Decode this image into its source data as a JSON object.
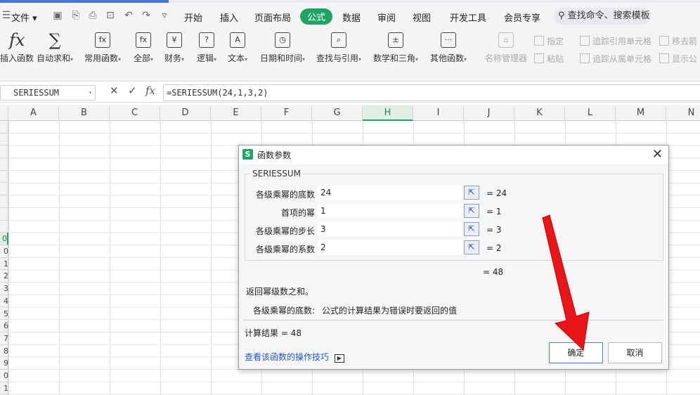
{
  "menu": {
    "file": "文件",
    "tabs": [
      "开始",
      "插入",
      "页面布局",
      "公式",
      "数据",
      "审阅",
      "视图",
      "开发工具",
      "会员专享"
    ],
    "active_tab": "公式",
    "search": "查找命令、搜索模板"
  },
  "ribbon": {
    "buttons": [
      {
        "icon": "fx",
        "label": "插入函数"
      },
      {
        "icon": "∑",
        "label": "自动求和"
      },
      {
        "icon": "fx",
        "label": "常用函数"
      },
      {
        "icon": "fx",
        "label": "全部"
      },
      {
        "icon": "¥",
        "label": "财务"
      },
      {
        "icon": "?",
        "label": "逻辑"
      },
      {
        "icon": "A",
        "label": "文本"
      },
      {
        "icon": "◷",
        "label": "日期和时间"
      },
      {
        "icon": "⌕",
        "label": "查找与引用"
      },
      {
        "icon": "±",
        "label": "数学和三角"
      },
      {
        "icon": "···",
        "label": "其他函数"
      }
    ],
    "name_manager": "名称管理器",
    "assign": "指定",
    "paste": "粘贴",
    "trace_precedents": "追踪引用单元格",
    "trace_dependents": "追踪从属单元格",
    "remove_arrows": "移去箭",
    "show_formulas": "显示公"
  },
  "formula_bar": {
    "name_box": "SERIESSUM",
    "formula": "=SERIESSUM(24,1,3,2)"
  },
  "columns": [
    "A",
    "B",
    "C",
    "D",
    "E",
    "F",
    "G",
    "H",
    "I",
    "J",
    "K",
    "L",
    "M",
    "N"
  ],
  "selected_column": "H",
  "rows": [
    "",
    "",
    "",
    "",
    "",
    "",
    "",
    "",
    "",
    "0",
    "0",
    "1",
    "2",
    "3",
    "4",
    "5",
    "6",
    "7",
    "8",
    "9",
    "0",
    "1"
  ],
  "dialog": {
    "title": "函数参数",
    "function_name": "SERIESSUM",
    "params": [
      {
        "label": "各级乘幂的底数",
        "value": "24",
        "result": "= 24"
      },
      {
        "label": "首项的幂",
        "value": "1",
        "result": "= 1"
      },
      {
        "label": "各级乘幂的步长",
        "value": "3",
        "result": "= 3"
      },
      {
        "label": "各级乘幂的系数",
        "value": "2",
        "result": "= 2"
      }
    ],
    "total": "= 48",
    "description": "返回幂级数之和。",
    "param_help_label": "各级乘幂的底数:",
    "param_help_text": "公式的计算结果为错误时要返回的值",
    "calc_result": "计算结果 = 48",
    "help_link": "查看该函数的操作技巧",
    "ok": "确定",
    "cancel": "取消"
  },
  "colors": {
    "accent": "#21a366",
    "arrow": "#e8161b",
    "link": "#2358c4"
  }
}
